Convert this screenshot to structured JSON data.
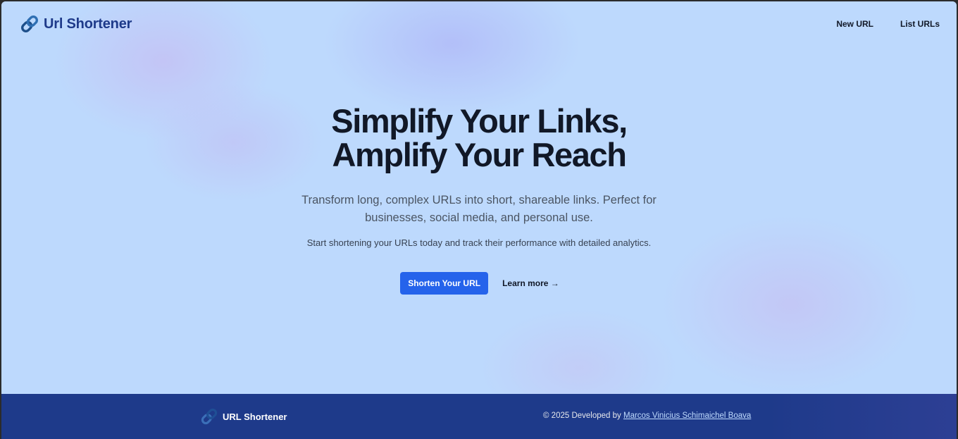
{
  "header": {
    "brand": "Url Shortener",
    "brand_icon": "link-icon",
    "nav": [
      {
        "label": "New URL"
      },
      {
        "label": "List URLs"
      }
    ]
  },
  "hero": {
    "title_line1": "Simplify Your Links,",
    "title_line2": "Amplify Your Reach",
    "lead": "Transform long, complex URLs into short, shareable links. Perfect for businesses, social media, and personal use.",
    "subtext": "Start shortening your URLs today and track their performance with detailed analytics.",
    "primary_button": "Shorten Your URL",
    "secondary_link": "Learn more →"
  },
  "footer": {
    "brand": "URL Shortener",
    "brand_icon": "link-icon",
    "copyright_prefix": "© 2025 Developed by",
    "author": "Marcos Vinicius Schimaichel Boava"
  },
  "colors": {
    "background": "#bfdbfe",
    "brand": "#1e3a8a",
    "primary": "#2563eb",
    "footer": "#1e3a8a",
    "heading": "#111827"
  }
}
